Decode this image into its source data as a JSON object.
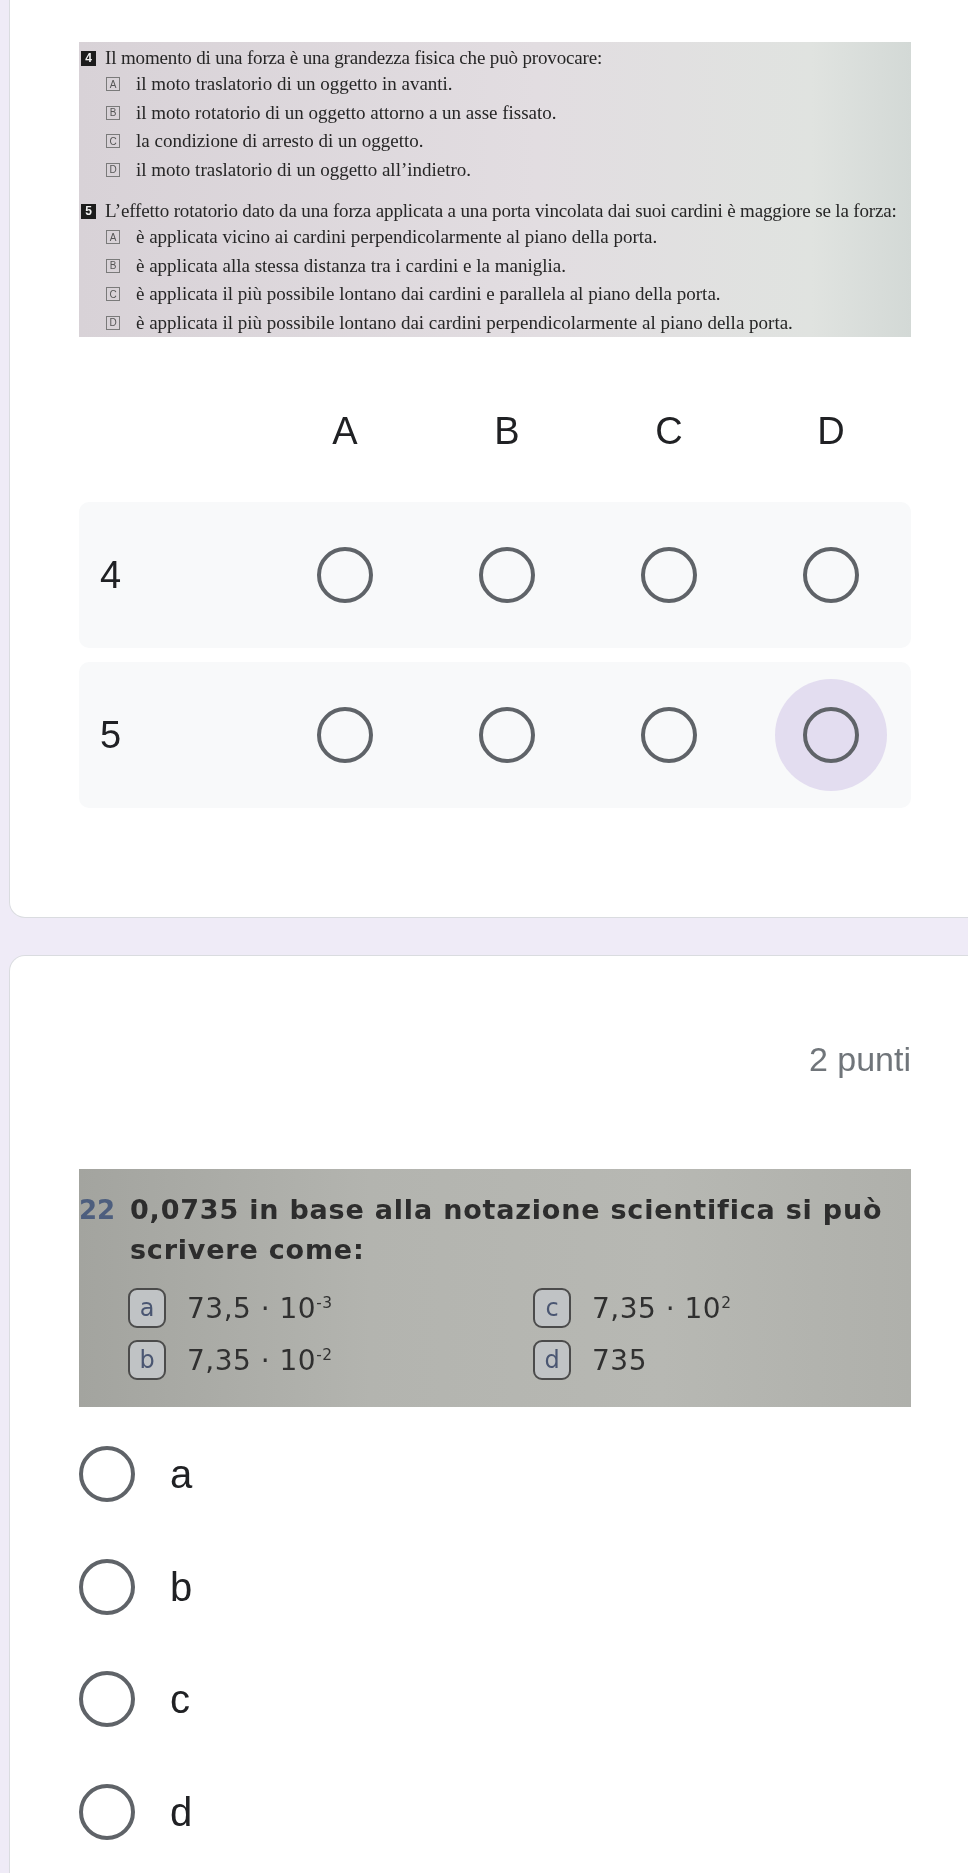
{
  "grid_question": {
    "image": {
      "questions": [
        {
          "number": "4",
          "text": "Il momento di una forza è una grandezza fisica che può provocare:",
          "options": [
            {
              "letter": "A",
              "text": "il moto traslatorio di un oggetto in avanti."
            },
            {
              "letter": "B",
              "text": "il moto rotatorio di un oggetto attorno a un asse fissato."
            },
            {
              "letter": "C",
              "text": "la condizione di arresto di un oggetto."
            },
            {
              "letter": "D",
              "text": "il moto traslatorio di un oggetto all’indietro."
            }
          ]
        },
        {
          "number": "5",
          "text": "L’effetto rotatorio dato da una forza applicata a una porta vincolata dai suoi cardini è maggiore se la forza:",
          "options": [
            {
              "letter": "A",
              "text": "è applicata vicino ai cardini perpendicolarmente al piano della porta."
            },
            {
              "letter": "B",
              "text": "è applicata alla stessa distanza tra i cardini e la maniglia."
            },
            {
              "letter": "C",
              "text": "è applicata il più possibile lontano dai cardini e parallela al piano della porta."
            },
            {
              "letter": "D",
              "text": "è applicata il più possibile lontano dai cardini perpendicolarmente al piano della porta."
            }
          ]
        }
      ]
    },
    "columns": [
      "A",
      "B",
      "C",
      "D"
    ],
    "rows": [
      {
        "label": "4",
        "cells": [
          {
            "selected": false,
            "focused": false
          },
          {
            "selected": false,
            "focused": false
          },
          {
            "selected": false,
            "focused": false
          },
          {
            "selected": false,
            "focused": false
          }
        ]
      },
      {
        "label": "5",
        "cells": [
          {
            "selected": false,
            "focused": false
          },
          {
            "selected": false,
            "focused": false
          },
          {
            "selected": false,
            "focused": false
          },
          {
            "selected": false,
            "focused": true
          }
        ]
      }
    ]
  },
  "choice_question": {
    "points": "2 punti",
    "image": {
      "number": "22",
      "text": "0,0735 in base alla notazione scientifica si può scrivere come:",
      "options": [
        {
          "letter": "a",
          "text": "73,5 · 10$^{-3}$"
        },
        {
          "letter": "b",
          "text": "7,35 · 10$^{-2}$"
        },
        {
          "letter": "c",
          "text": "7,35 · 10$^{2}$"
        },
        {
          "letter": "d",
          "text": "735"
        }
      ]
    },
    "options": [
      {
        "label": "a",
        "selected": false
      },
      {
        "label": "b",
        "selected": false
      },
      {
        "label": "c",
        "selected": false
      },
      {
        "label": "d",
        "selected": false
      }
    ]
  }
}
